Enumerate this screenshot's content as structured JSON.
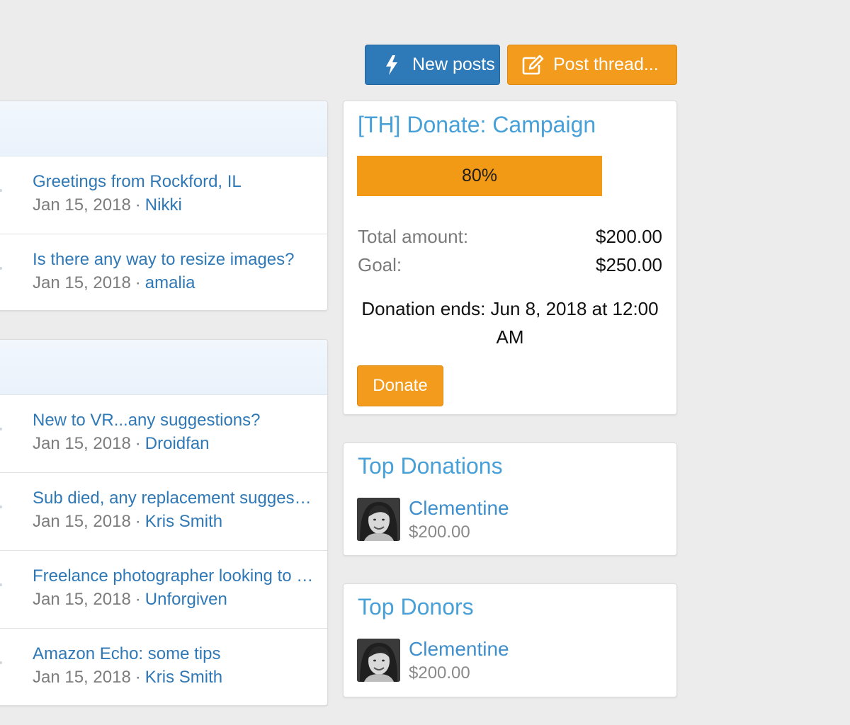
{
  "toolbar": {
    "new_posts_label": "New posts",
    "post_thread_label": "Post thread...",
    "new_posts_icon": "bolt-icon",
    "post_thread_icon": "edit-icon",
    "colors": {
      "new_posts": "#2e79b8",
      "post_thread": "#f39b1c"
    }
  },
  "thread_blocks": [
    {
      "threads": [
        {
          "title": "Greetings from Rockford, IL",
          "date": "Jan 15, 2018",
          "sep": "·",
          "user": "Nikki"
        },
        {
          "title": "Is there any way to resize images?",
          "date": "Jan 15, 2018",
          "sep": "·",
          "user": "amalia"
        }
      ]
    },
    {
      "threads": [
        {
          "title": "New to VR...any suggestions?",
          "date": "Jan 15, 2018",
          "sep": "·",
          "user": "Droidfan"
        },
        {
          "title": "Sub died, any replacement suggestions?",
          "date": "Jan 15, 2018",
          "sep": "·",
          "user": "Kris Smith"
        },
        {
          "title": "Freelance photographer looking to connect",
          "date": "Jan 15, 2018",
          "sep": "·",
          "user": "Unforgiven"
        },
        {
          "title": "Amazon Echo: some tips",
          "date": "Jan 15, 2018",
          "sep": "·",
          "user": "Kris Smith"
        }
      ]
    }
  ],
  "donation": {
    "title": "[TH] Donate: Campaign",
    "progress_percent": 80,
    "progress_label": "80%",
    "total_label": "Total amount:",
    "total_value": "$200.00",
    "goal_label": "Goal:",
    "goal_value": "$250.00",
    "ends_text": "Donation ends: Jun 8, 2018 at 12:00 AM",
    "button_label": "Donate",
    "accent_color": "#f29a16"
  },
  "top_donations": {
    "title": "Top Donations",
    "items": [
      {
        "name": "Clementine",
        "amount": "$200.00"
      }
    ]
  },
  "top_donors": {
    "title": "Top Donors",
    "items": [
      {
        "name": "Clementine",
        "amount": "$200.00"
      }
    ]
  }
}
